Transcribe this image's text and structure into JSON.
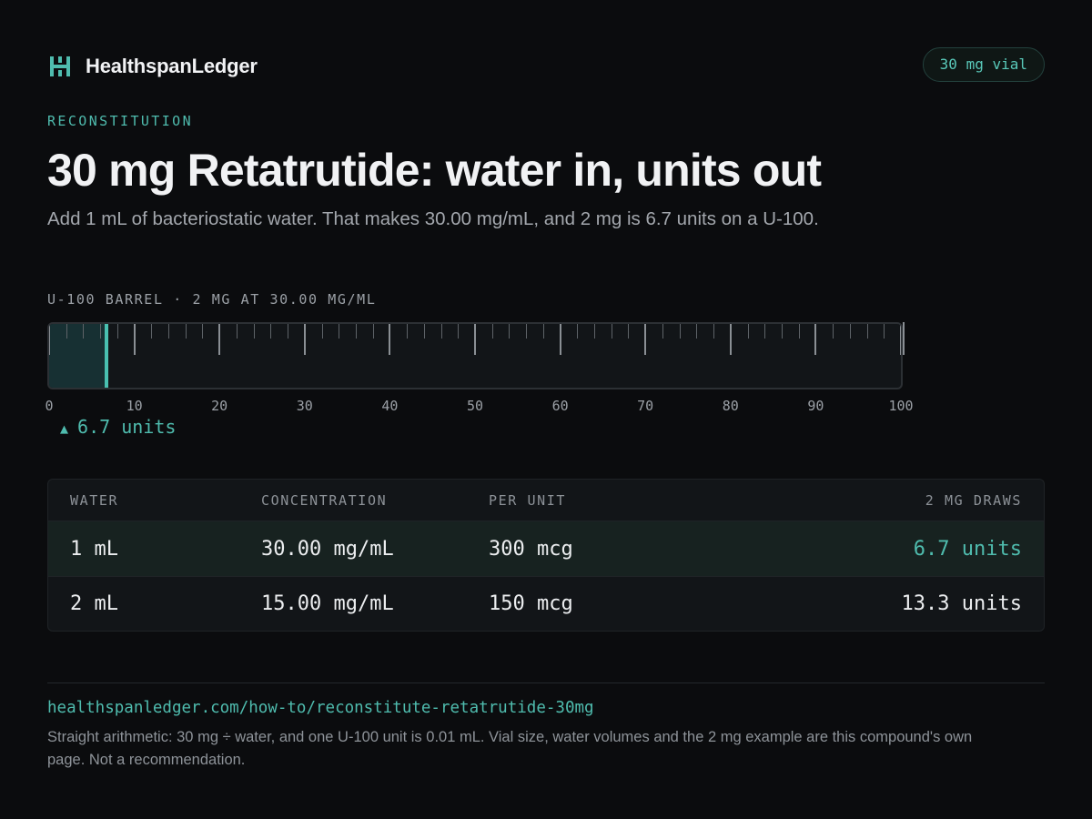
{
  "brand": {
    "name": "HealthspanLedger",
    "logo_icon": "hl-monogram-icon",
    "accent": "#4fbcae"
  },
  "badge": {
    "label": "30 mg vial"
  },
  "eyebrow": "RECONSTITUTION",
  "title": "30 mg Retatrutide: water in, units out",
  "subtitle": "Add 1 mL of bacteriostatic water. That makes 30.00 mg/mL, and 2 mg is 6.7 units on a U-100.",
  "gauge": {
    "caption": "U-100 BARREL · 2 MG AT 30.00 MG/ML",
    "min": 0,
    "max": 100,
    "major_step": 10,
    "minor_step": 2,
    "value": 6.7,
    "scale_labels": [
      "0",
      "10",
      "20",
      "30",
      "40",
      "50",
      "60",
      "70",
      "80",
      "90",
      "100"
    ],
    "arrow_icon": "triangle-up-icon",
    "reading_label": "6.7 units"
  },
  "table": {
    "headers": [
      "WATER",
      "CONCENTRATION",
      "PER UNIT",
      "2 MG DRAWS"
    ],
    "rows": [
      {
        "water": "1 mL",
        "concentration": "30.00 mg/mL",
        "per_unit": "300 mcg",
        "draw": "6.7 units",
        "highlighted": true
      },
      {
        "water": "2 mL",
        "concentration": "15.00 mg/mL",
        "per_unit": "150 mcg",
        "draw": "13.3 units",
        "highlighted": false
      }
    ]
  },
  "footer": {
    "url": "healthspanledger.com/how-to/reconstitute-retatrutide-30mg",
    "note": "Straight arithmetic: 30 mg ÷ water, and one U-100 unit is 0.01 mL. Vial size, water volumes and the 2 mg example are this compound's own page. Not a recommendation."
  }
}
